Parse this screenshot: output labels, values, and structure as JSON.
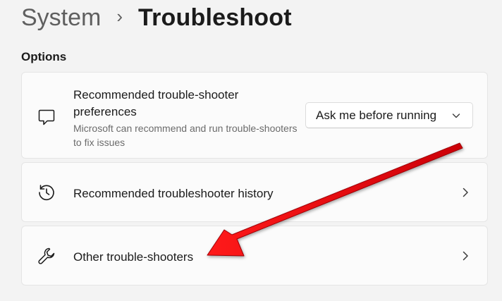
{
  "breadcrumb": {
    "parent": "System",
    "separator": "›",
    "current": "Troubleshoot"
  },
  "section_label": "Options",
  "cards": [
    {
      "title": "Recommended trouble-shooter preferences",
      "subtitle": "Microsoft can recommend and run trouble-shooters to fix issues",
      "icon": "chat-bubble-icon",
      "dropdown": {
        "value": "Ask me before running",
        "icon": "chevron-down-icon"
      }
    },
    {
      "title": "Recommended troubleshooter history",
      "icon": "history-icon",
      "trailing_icon": "chevron-right-icon"
    },
    {
      "title": "Other trouble-shooters",
      "icon": "wrench-icon",
      "trailing_icon": "chevron-right-icon"
    }
  ],
  "annotation": {
    "type": "red-arrow",
    "color": "#e8000b",
    "points_to": "Other trouble-shooters"
  },
  "colors": {
    "background": "#f3f3f3",
    "card": "#fbfbfb",
    "border": "#e5e5e5",
    "text": "#1b1b1b",
    "muted": "#6b6b6b"
  }
}
